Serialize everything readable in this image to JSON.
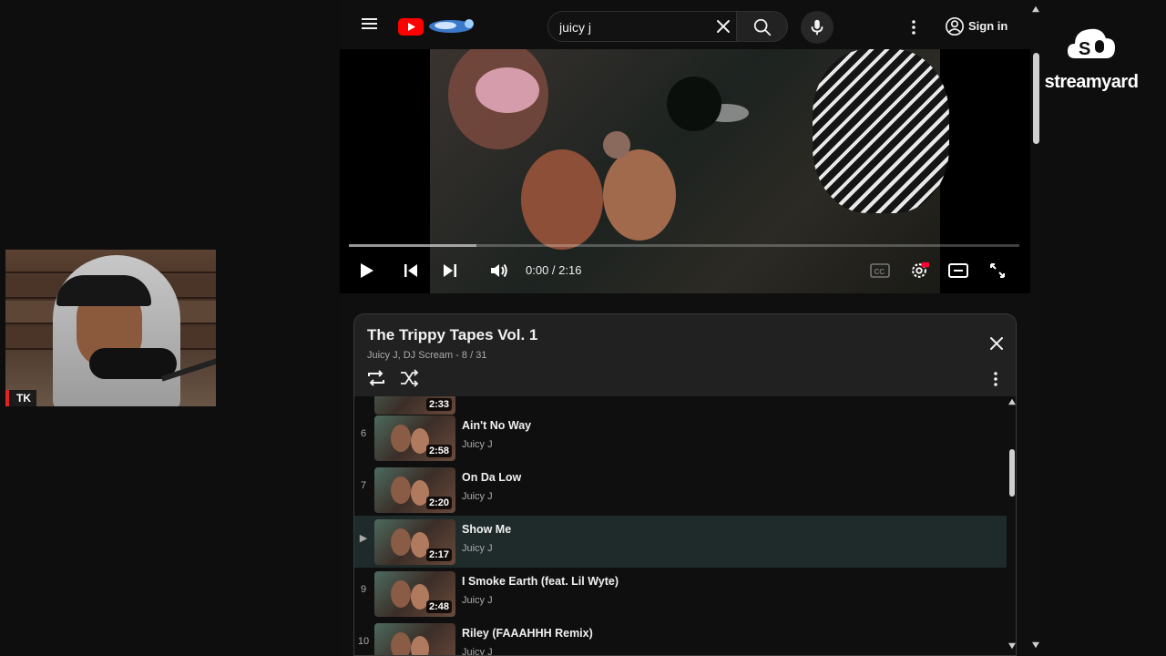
{
  "overlay": {
    "webcam_label": "TK",
    "brand_name": "streamyard"
  },
  "header": {
    "search_value": "juicy j",
    "sign_in_label": "Sign in"
  },
  "player": {
    "time": "0:00 / 2:16",
    "buffered_fraction": 0.19
  },
  "playlist": {
    "title": "The Trippy Tapes Vol. 1",
    "meta": "Juicy J, DJ Scream - 8 / 31",
    "partial_top_duration": "2:33",
    "items": [
      {
        "index": "6",
        "title": "Ain't No Way",
        "artist": "Juicy J",
        "duration": "2:58",
        "active": false
      },
      {
        "index": "7",
        "title": "On Da Low",
        "artist": "Juicy J",
        "duration": "2:20",
        "active": false
      },
      {
        "index": "▶",
        "title": "Show Me",
        "artist": "Juicy J",
        "duration": "2:17",
        "active": true
      },
      {
        "index": "9",
        "title": "I Smoke Earth (feat. Lil Wyte)",
        "artist": "Juicy J",
        "duration": "2:48",
        "active": false
      },
      {
        "index": "10",
        "title": "Riley (FAAAHHH Remix)",
        "artist": "Juicy J",
        "duration": "",
        "active": false
      }
    ]
  },
  "colors": {
    "background": "#0f0f0f",
    "youtube_red": "#ff0000",
    "active_row": "#1f2a2a",
    "hd_badge": "#ff0033"
  }
}
